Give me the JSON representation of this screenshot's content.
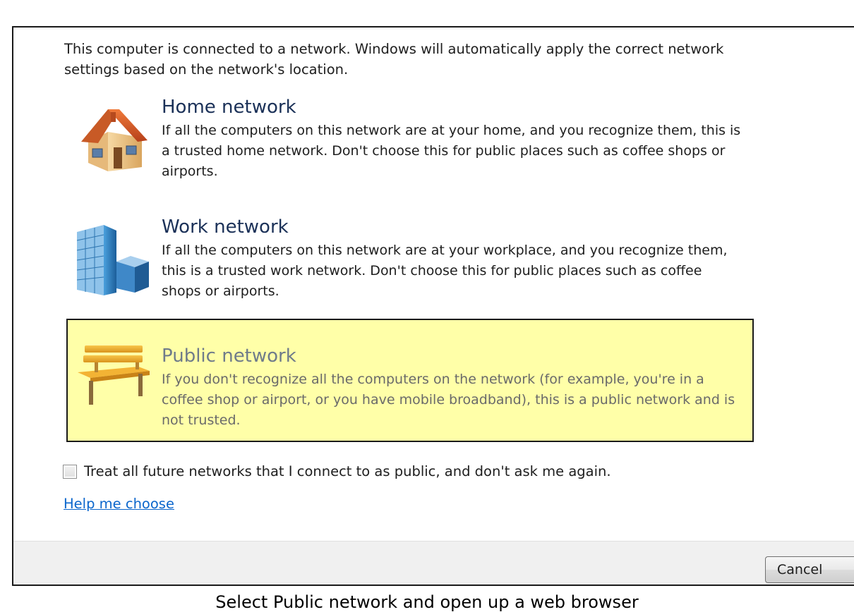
{
  "dialog": {
    "intro": "This computer is connected to a network. Windows will automatically apply the correct network settings based on the network's location.",
    "options": [
      {
        "icon": "house-icon",
        "title": "Home network",
        "description": "If all the computers on this network are at your home, and you recognize them, this is a trusted home network.  Don't choose this for public places such as coffee shops or airports.",
        "selected": false
      },
      {
        "icon": "office-building-icon",
        "title": "Work network",
        "description": "If all the computers on this network are at your workplace, and you recognize them, this is a trusted work network.  Don't choose this for public places such as coffee shops or airports.",
        "selected": false
      },
      {
        "icon": "park-bench-icon",
        "title": "Public network",
        "description": "If you don't recognize all the computers on the network (for example, you're in a coffee shop or airport, or you have mobile broadband), this is a public network and is not trusted.",
        "selected": true
      }
    ],
    "checkbox": {
      "label": "Treat all future networks that I connect to as public, and don't ask me again.",
      "checked": false
    },
    "help_link": "Help me choose",
    "cancel_label": "Cancel",
    "colors": {
      "highlight": "#ffffa8",
      "link": "#0b66cc",
      "title": "#1b3158"
    }
  },
  "caption": "Select Public network and open up a web browser"
}
